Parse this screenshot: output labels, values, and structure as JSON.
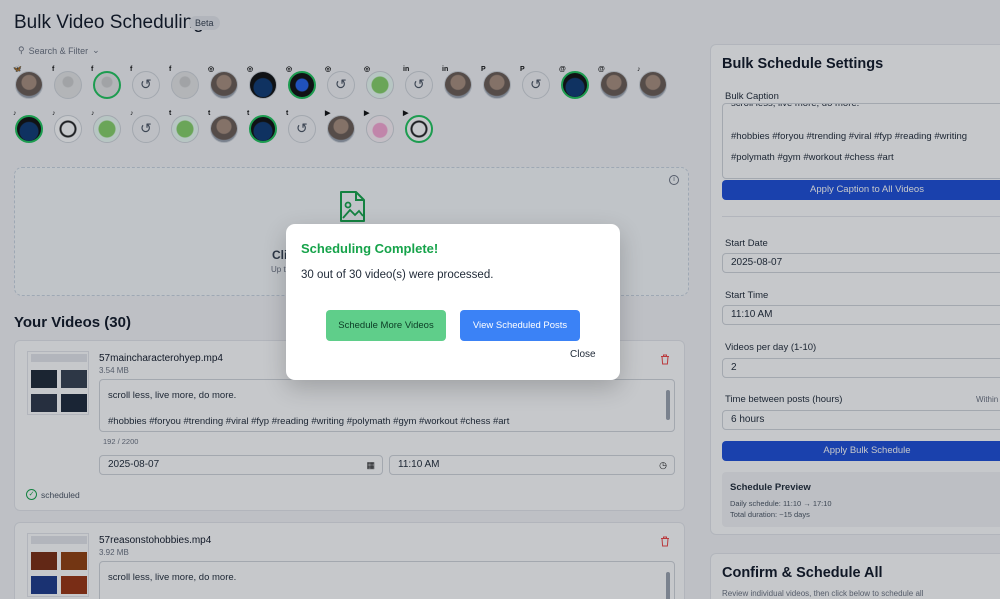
{
  "header": {
    "title": "Bulk Video Scheduling",
    "badge": "Beta",
    "search_filter": "Search & Filter"
  },
  "accounts": {
    "row1": [
      {
        "network": "bluesky",
        "net_glyph": "🦋",
        "kind": "face",
        "selected": false
      },
      {
        "network": "facebook",
        "net_glyph": "f",
        "kind": "blank",
        "selected": false
      },
      {
        "network": "facebook",
        "net_glyph": "f",
        "kind": "blank",
        "selected": true
      },
      {
        "network": "facebook",
        "net_glyph": "f",
        "kind": "thread",
        "selected": false
      },
      {
        "network": "facebook",
        "net_glyph": "f",
        "kind": "blank",
        "selected": false
      },
      {
        "network": "instagram",
        "net_glyph": "◎",
        "kind": "face",
        "selected": false
      },
      {
        "network": "instagram",
        "net_glyph": "◎",
        "kind": "dark",
        "selected": false
      },
      {
        "network": "instagram",
        "net_glyph": "◎",
        "kind": "phone",
        "selected": true
      },
      {
        "network": "instagram",
        "net_glyph": "◎",
        "kind": "thread",
        "selected": false
      },
      {
        "network": "instagram",
        "net_glyph": "◎",
        "kind": "green",
        "selected": false
      },
      {
        "network": "linkedin",
        "net_glyph": "in",
        "kind": "thread",
        "selected": false
      },
      {
        "network": "linkedin",
        "net_glyph": "in",
        "kind": "face",
        "selected": false
      },
      {
        "network": "pinterest",
        "net_glyph": "P",
        "kind": "face",
        "selected": false
      },
      {
        "network": "pinterest",
        "net_glyph": "P",
        "kind": "thread",
        "selected": false
      },
      {
        "network": "threads",
        "net_glyph": "@",
        "kind": "dark",
        "selected": true
      },
      {
        "network": "threads",
        "net_glyph": "@",
        "kind": "face",
        "selected": false
      },
      {
        "network": "tiktok",
        "net_glyph": "♪",
        "kind": "face",
        "selected": false
      }
    ],
    "row2": [
      {
        "network": "tiktok",
        "net_glyph": "♪",
        "kind": "dark",
        "selected": true
      },
      {
        "network": "tiktok",
        "net_glyph": "♪",
        "kind": "sketch",
        "selected": false
      },
      {
        "network": "tiktok",
        "net_glyph": "♪",
        "kind": "green",
        "selected": false
      },
      {
        "network": "tiktok",
        "net_glyph": "♪",
        "kind": "thread",
        "selected": false
      },
      {
        "network": "twitter",
        "net_glyph": "t",
        "kind": "green",
        "selected": false
      },
      {
        "network": "twitter",
        "net_glyph": "t",
        "kind": "face",
        "selected": false
      },
      {
        "network": "twitter",
        "net_glyph": "t",
        "kind": "dark",
        "selected": true
      },
      {
        "network": "twitter",
        "net_glyph": "t",
        "kind": "thread",
        "selected": false
      },
      {
        "network": "youtube",
        "net_glyph": "▶",
        "kind": "face",
        "selected": false
      },
      {
        "network": "youtube",
        "net_glyph": "▶",
        "kind": "pig",
        "selected": false
      },
      {
        "network": "youtube",
        "net_glyph": "▶",
        "kind": "sketch",
        "selected": true
      }
    ]
  },
  "upload": {
    "click_text": "Cli",
    "hint_text": "Up t",
    "icon": "image-file-icon",
    "info_icon": "info-icon"
  },
  "videos": {
    "title": "Your Videos (30)",
    "items": [
      {
        "filename": "57maincharacterohyep.mp4",
        "size": "3.54 MB",
        "caption_line1": "scroll less, live more, do more.",
        "caption_line2": "#hobbies #foryou #trending #viral #fyp #reading #writing #polymath #gym #workout #chess #art",
        "counter": "192 / 2200",
        "date": "2025-08-07",
        "time": "11:10 AM",
        "status": "scheduled"
      },
      {
        "filename": "57reasonstohobbies.mp4",
        "size": "3.92 MB",
        "caption_line1": "scroll less, live more, do more."
      }
    ]
  },
  "settings": {
    "title": "Bulk Schedule Settings",
    "caption_label": "Bulk Caption",
    "caption_cut": "scroll less, live more, do more.",
    "caption_line2": "#hobbies #foryou #trending #viral #fyp #reading #writing",
    "caption_line3": "#polymath #gym #workout #chess #art",
    "apply_caption": "Apply Caption to All Videos",
    "start_date_label": "Start Date",
    "start_date": "2025-08-07",
    "start_time_label": "Start Time",
    "start_time": "11:10 AM",
    "per_day_label": "Videos per day (1-10)",
    "per_day": "2",
    "between_label": "Time between posts (hours)",
    "within": "Within",
    "between": "6 hours",
    "apply_bulk": "Apply Bulk Schedule",
    "preview_title": "Schedule Preview",
    "preview_daily": "Daily schedule: 11:10 → 17:10",
    "preview_total": "Total duration: ~15 days"
  },
  "confirm": {
    "title": "Confirm & Schedule All",
    "subtitle": "Review individual videos, then click below to schedule all"
  },
  "modal": {
    "title": "Scheduling Complete!",
    "message": "30 out of 30 video(s) were processed.",
    "schedule_more": "Schedule More Videos",
    "view_posts": "View Scheduled Posts",
    "close": "Close"
  },
  "colors": {
    "accent_blue": "#1d4ed8",
    "success_green": "#16a34a",
    "button_green": "#5fce8a",
    "button_blue": "#3b82f6"
  }
}
